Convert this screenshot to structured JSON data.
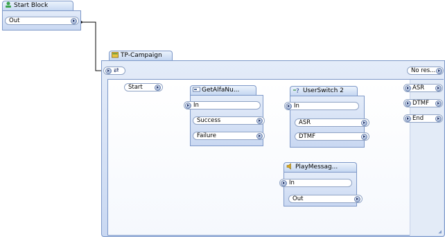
{
  "start_block": {
    "title": "Start Block",
    "out_port": "Out"
  },
  "campaign": {
    "title": "TP-Campaign",
    "no_result_port": "No res...",
    "start_port": "Start",
    "outputs": [
      "ASR",
      "DTMF",
      "End"
    ]
  },
  "get_alfa": {
    "title": "GetAlfaNu...",
    "in_port": "In",
    "success": "Success",
    "failure": "Failure"
  },
  "user_switch": {
    "title": "UserSwitch 2",
    "in_port": "In",
    "asr": "ASR",
    "dtmf": "DTMF"
  },
  "play_message": {
    "title": "PlayMessag...",
    "in_port": "In",
    "out_port": "Out"
  },
  "colors": {
    "border": "#7d98c8",
    "header": "#c4d6f1",
    "wire": "#000000"
  }
}
